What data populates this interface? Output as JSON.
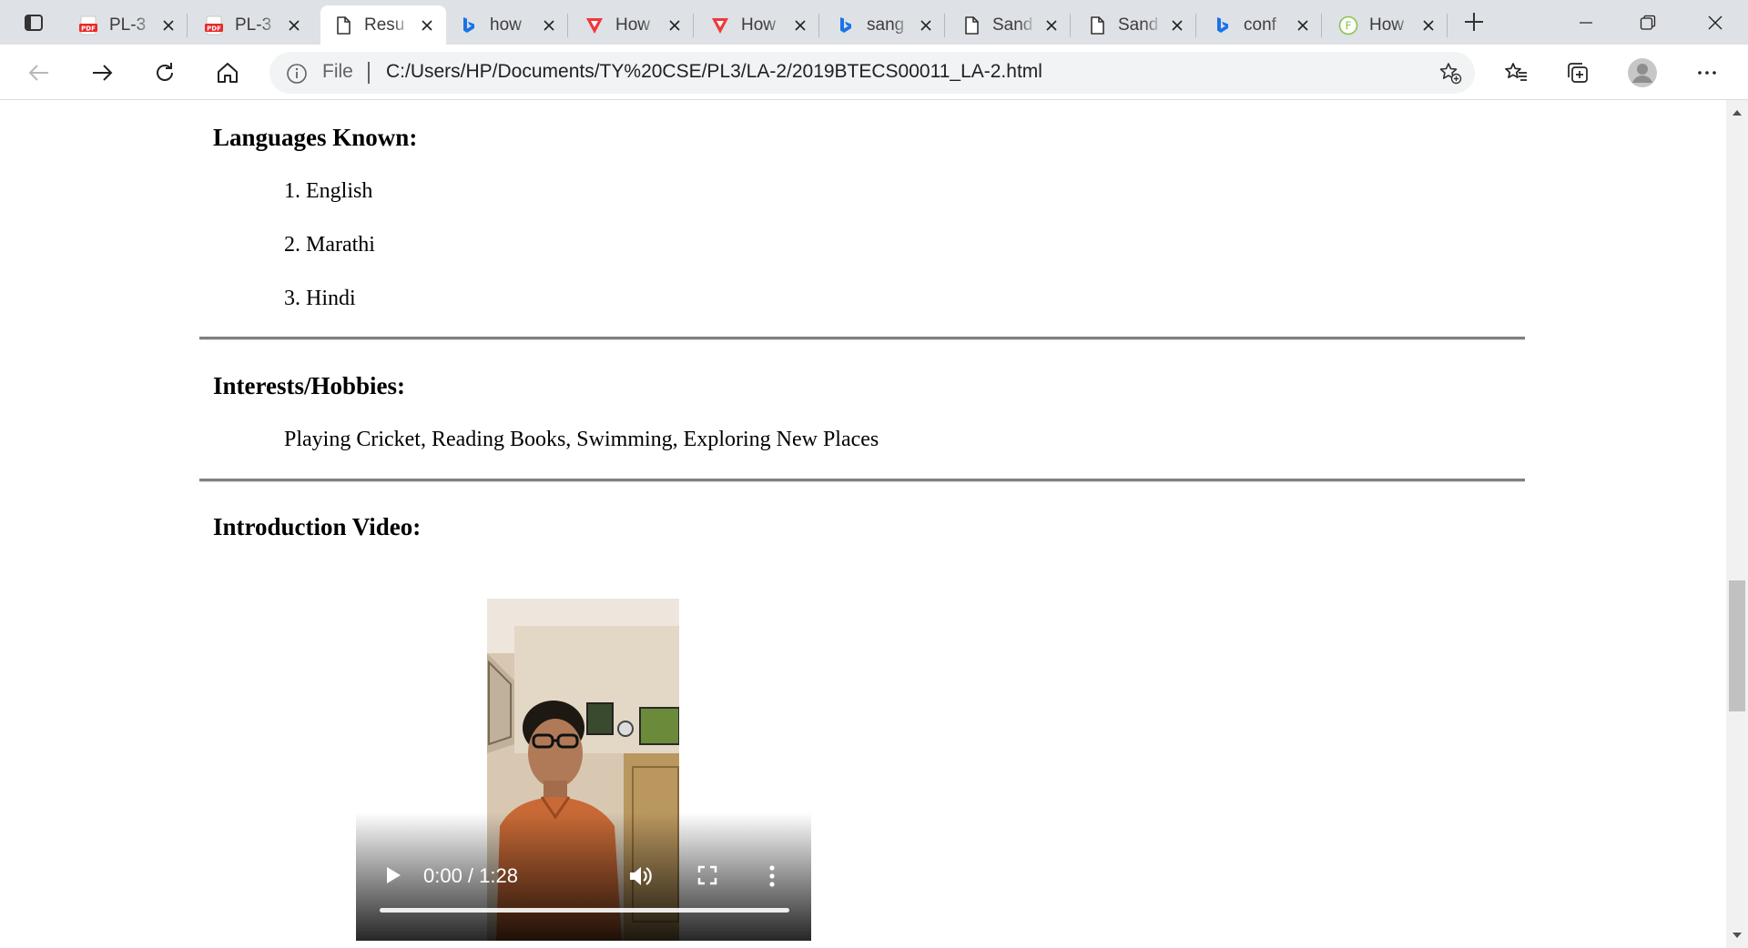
{
  "browser": {
    "tabs": [
      {
        "title": "PL-3",
        "favicon": "pdf-icon"
      },
      {
        "title": "PL-3",
        "favicon": "pdf-icon"
      },
      {
        "title": "Resu",
        "favicon": "page-icon",
        "active": true
      },
      {
        "title": "how",
        "favicon": "bing-icon"
      },
      {
        "title": "How",
        "favicon": "red-v-icon"
      },
      {
        "title": "How",
        "favicon": "red-v-icon"
      },
      {
        "title": "sang",
        "favicon": "bing-icon"
      },
      {
        "title": "Sand",
        "favicon": "page-icon"
      },
      {
        "title": "Sand",
        "favicon": "page-icon"
      },
      {
        "title": "conf",
        "favicon": "bing-icon"
      },
      {
        "title": "How",
        "favicon": "green-f-icon"
      }
    ],
    "address": {
      "scheme_label": "File",
      "url": "C:/Users/HP/Documents/TY%20CSE/PL3/LA-2/2019BTECS00011_LA-2.html"
    }
  },
  "page": {
    "languages": {
      "heading": "Languages Known:",
      "items": [
        "1. English",
        "2. Marathi",
        "3. Hindi"
      ]
    },
    "hobbies": {
      "heading": "Interests/Hobbies:",
      "text": "Playing Cricket, Reading Books, Swimming, Exploring New Places"
    },
    "intro": {
      "heading": "Introduction Video:",
      "video": {
        "time": "0:00 / 1:28",
        "progress_fraction": 0
      }
    }
  },
  "colors": {
    "tabstrip": "#dee1e6",
    "pdf_red": "#e52b2b",
    "bing_blue": "#1a73e8",
    "vivaldi_red": "#ef3939",
    "green": "#8bc34a"
  }
}
